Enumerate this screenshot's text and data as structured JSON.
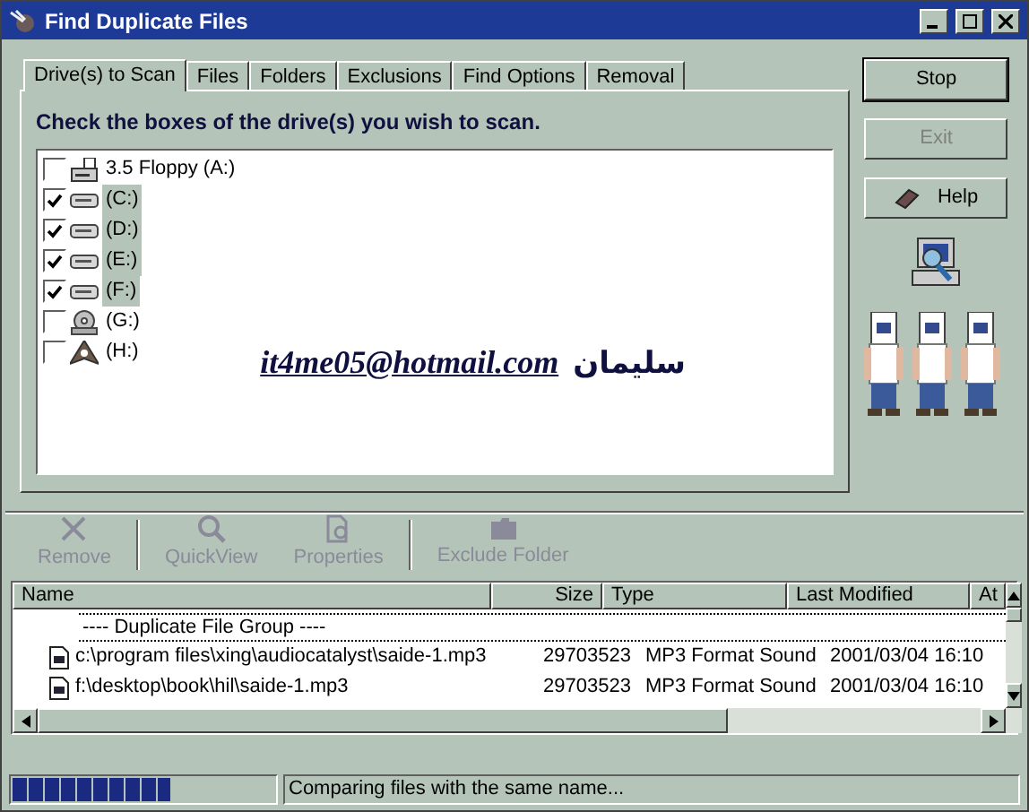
{
  "window": {
    "title": "Find Duplicate Files"
  },
  "tabs": [
    {
      "label": "Drive(s) to Scan",
      "selected": true
    },
    {
      "label": "Files",
      "selected": false
    },
    {
      "label": "Folders",
      "selected": false
    },
    {
      "label": "Exclusions",
      "selected": false
    },
    {
      "label": "Find Options",
      "selected": false
    },
    {
      "label": "Removal",
      "selected": false
    }
  ],
  "instruction": "Check the boxes of the drive(s) you wish to scan.",
  "drives": [
    {
      "kind": "floppy",
      "label": "3.5 Floppy (A:)",
      "checked": false,
      "selected": false
    },
    {
      "kind": "hdd",
      "label": "(C:)",
      "checked": true,
      "selected": true
    },
    {
      "kind": "hdd",
      "label": "(D:)",
      "checked": true,
      "selected": true
    },
    {
      "kind": "hdd",
      "label": "(E:)",
      "checked": true,
      "selected": true
    },
    {
      "kind": "hdd",
      "label": "(F:)",
      "checked": true,
      "selected": true
    },
    {
      "kind": "cdrom",
      "label": "(G:)",
      "checked": false,
      "selected": false
    },
    {
      "kind": "other",
      "label": "(H:)",
      "checked": false,
      "selected": false
    }
  ],
  "overlay_text": {
    "email": "it4me05@hotmail.com",
    "name": "سليمان"
  },
  "side_buttons": [
    {
      "label": "Stop",
      "disabled": false,
      "default": true
    },
    {
      "label": "Exit",
      "disabled": true,
      "default": false
    },
    {
      "label": "Help",
      "disabled": false,
      "default": false
    }
  ],
  "toolbar": [
    {
      "kind": "remove",
      "label": "Remove",
      "disabled": true
    },
    {
      "kind": "quickview",
      "label": "QuickView",
      "disabled": true
    },
    {
      "kind": "properties",
      "label": "Properties",
      "disabled": true
    },
    {
      "kind": "exclude",
      "label": "Exclude Folder",
      "disabled": true
    }
  ],
  "results": {
    "columns": [
      "Name",
      "Size",
      "Type",
      "Last Modified",
      "At"
    ],
    "group_label": "---- Duplicate File Group ----",
    "rows": [
      {
        "name": "c:\\program files\\xing\\audiocatalyst\\saide-1.mp3",
        "size": "29703523",
        "type": "MP3 Format Sound",
        "modified": "2001/03/04 16:10"
      },
      {
        "name": "f:\\desktop\\book\\hil\\saide-1.mp3",
        "size": "29703523",
        "type": "MP3 Format Sound",
        "modified": "2001/03/04 16:10"
      }
    ]
  },
  "status_bar": {
    "level": 0.6,
    "message": "Comparing files with the same name..."
  }
}
